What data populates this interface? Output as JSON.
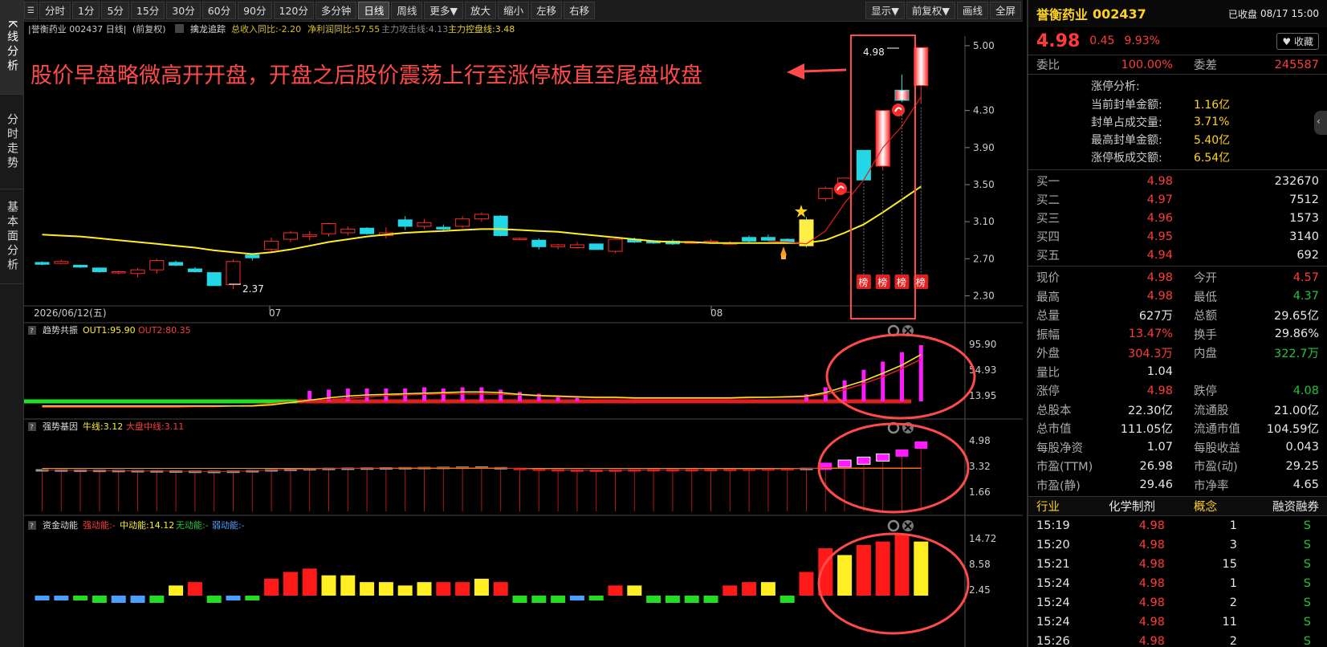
{
  "vtabs": [
    "K线分析",
    "分时走势",
    "基本面分析"
  ],
  "toolbar": {
    "left": [
      "分时",
      "1分",
      "5分",
      "15分",
      "30分",
      "60分",
      "90分",
      "120分",
      "多分钟",
      "日线",
      "周线",
      "更多▼",
      "放大",
      "缩小",
      "左移",
      "右移"
    ],
    "active": "日线",
    "right": [
      "显示▼",
      "前复权▼",
      "画线",
      "全屏"
    ]
  },
  "chart_header": {
    "stock": "|誉衡药业 002437 日线|",
    "adj": "(前复权)",
    "indicator": "擒龙追踪",
    "revenue": "总收入同比:-2.20",
    "profit": "净利润同比:57.55",
    "attack": "主力攻击线:4.13",
    "control": "主力控盘线:3.48"
  },
  "annotation": "股价早盘略微高开开盘，开盘之后股价震荡上行至涨停板直至尾盘收盘",
  "main_axis": [
    "5.00",
    "4.30",
    "3.90",
    "3.50",
    "3.10",
    "2.70",
    "2.30"
  ],
  "date_labels": [
    "2026/06/12(五)",
    "07",
    "08"
  ],
  "price_marks": {
    "low": "2.37",
    "high": "4.98"
  },
  "bang": "榜",
  "panels": {
    "p1": {
      "q": "?",
      "name": "趋势共振",
      "v1": "OUT1:95.90",
      "v2": "OUT2:80.35",
      "axis": [
        "95.90",
        "54.93",
        "13.95"
      ]
    },
    "p2": {
      "q": "?",
      "name": "强势基因",
      "v1": "牛线:3.12",
      "v2": "大盘中线:3.11",
      "axis": [
        "4.98",
        "3.32",
        "1.66"
      ]
    },
    "p3": {
      "q": "?",
      "name": "资金动能",
      "v1": "强动能:-",
      "v2": "中动能:14.12",
      "v3": "无动能:-",
      "v4": "弱动能:-",
      "axis": [
        "14.72",
        "8.58",
        "2.45"
      ]
    }
  },
  "chart_data": {
    "type": "candlestick",
    "ohlc": [
      [
        2.66,
        2.67,
        2.63,
        2.64
      ],
      [
        2.65,
        2.69,
        2.64,
        2.67
      ],
      [
        2.63,
        2.63,
        2.6,
        2.61
      ],
      [
        2.6,
        2.6,
        2.55,
        2.56
      ],
      [
        2.55,
        2.57,
        2.53,
        2.56
      ],
      [
        2.54,
        2.6,
        2.5,
        2.58
      ],
      [
        2.58,
        2.7,
        2.54,
        2.68
      ],
      [
        2.66,
        2.68,
        2.62,
        2.63
      ],
      [
        2.59,
        2.61,
        2.55,
        2.56
      ],
      [
        2.55,
        2.55,
        2.41,
        2.41
      ],
      [
        2.42,
        2.69,
        2.37,
        2.67
      ],
      [
        2.74,
        2.76,
        2.68,
        2.71
      ],
      [
        2.8,
        2.93,
        2.78,
        2.89
      ],
      [
        2.91,
        3.0,
        2.88,
        2.98
      ],
      [
        2.94,
        3.0,
        2.9,
        2.96
      ],
      [
        2.97,
        3.09,
        2.94,
        3.08
      ],
      [
        2.98,
        3.05,
        2.95,
        3.02
      ],
      [
        3.03,
        3.04,
        2.96,
        2.97
      ],
      [
        2.95,
        3.04,
        2.92,
        2.98
      ],
      [
        3.12,
        3.16,
        3.01,
        3.05
      ],
      [
        3.05,
        3.13,
        3.02,
        3.09
      ],
      [
        3.04,
        3.07,
        2.99,
        3.02
      ],
      [
        3.05,
        3.16,
        3.03,
        3.13
      ],
      [
        3.13,
        3.2,
        3.1,
        3.18
      ],
      [
        3.16,
        3.17,
        2.94,
        2.95
      ],
      [
        2.92,
        2.93,
        2.9,
        2.92
      ],
      [
        2.9,
        2.92,
        2.8,
        2.83
      ],
      [
        2.83,
        2.86,
        2.8,
        2.85
      ],
      [
        2.82,
        2.88,
        2.81,
        2.85
      ],
      [
        2.86,
        2.86,
        2.8,
        2.8
      ],
      [
        2.78,
        2.92,
        2.76,
        2.91
      ],
      [
        2.91,
        2.93,
        2.87,
        2.88
      ],
      [
        2.89,
        2.9,
        2.86,
        2.87
      ],
      [
        2.89,
        2.91,
        2.85,
        2.86
      ],
      [
        2.88,
        2.89,
        2.86,
        2.88
      ],
      [
        2.88,
        2.91,
        2.87,
        2.89
      ],
      [
        2.87,
        2.89,
        2.85,
        2.87
      ],
      [
        2.93,
        2.95,
        2.87,
        2.89
      ],
      [
        2.93,
        2.96,
        2.89,
        2.9
      ],
      [
        2.91,
        2.92,
        2.86,
        2.87
      ],
      [
        3.12,
        3.15,
        2.82,
        2.84
      ],
      [
        3.35,
        3.48,
        3.32,
        3.46
      ],
      [
        3.42,
        3.53,
        3.42,
        3.57
      ],
      [
        3.87,
        3.87,
        3.55,
        3.55
      ],
      [
        3.7,
        4.3,
        3.65,
        4.3
      ],
      [
        4.52,
        4.69,
        4.39,
        4.41
      ],
      [
        4.57,
        4.98,
        4.37,
        4.98
      ]
    ],
    "ma_yellow": [
      2.96,
      2.95,
      2.94,
      2.92,
      2.9,
      2.88,
      2.86,
      2.84,
      2.82,
      2.79,
      2.77,
      2.75,
      2.77,
      2.8,
      2.84,
      2.88,
      2.91,
      2.94,
      2.96,
      2.98,
      2.99,
      3.0,
      3.01,
      3.02,
      3.02,
      3.01,
      3.0,
      2.99,
      2.97,
      2.95,
      2.93,
      2.91,
      2.89,
      2.88,
      2.88,
      2.87,
      2.87,
      2.87,
      2.87,
      2.87,
      2.87,
      2.9,
      2.98,
      3.07,
      3.2,
      3.34,
      3.48
    ],
    "ma_red": [
      2.64,
      2.66,
      2.64,
      2.61,
      2.59,
      2.6,
      2.63,
      2.64,
      2.61,
      2.55,
      2.59,
      2.69,
      2.82,
      2.93,
      2.97,
      3.02,
      3.05,
      3.01,
      3.0,
      3.04,
      3.06,
      3.03,
      3.08,
      3.13,
      3.0,
      2.95,
      2.88,
      2.86,
      2.84,
      2.82,
      2.86,
      2.87,
      2.87,
      2.87,
      2.88,
      2.89,
      2.88,
      2.89,
      2.89,
      2.88,
      2.86,
      3.0,
      3.3,
      3.55,
      3.9,
      4.13,
      4.45
    ],
    "p1_a": [
      -8,
      -8,
      -8,
      -8,
      -8,
      -8,
      -8,
      -8,
      -8,
      -8,
      -8,
      -8,
      -6,
      -2,
      2,
      6,
      9,
      11,
      12,
      13,
      14,
      15,
      16,
      16,
      15,
      12,
      10,
      9,
      8,
      7,
      7,
      6,
      6,
      6,
      6,
      6,
      6,
      7,
      7,
      8,
      9,
      15,
      25,
      35,
      48,
      62,
      80
    ],
    "p1_b": [
      -10,
      -10,
      -10,
      -10,
      -10,
      -10,
      -10,
      -10,
      -9,
      -9,
      -8,
      -7,
      -4,
      -1,
      1,
      3,
      5,
      8,
      10,
      11,
      12,
      13,
      13,
      13,
      12,
      11,
      9,
      8,
      7,
      6,
      6,
      5,
      5,
      5,
      5,
      5,
      5,
      6,
      7,
      7,
      8,
      12,
      20,
      30,
      42,
      56,
      72
    ],
    "p1_bars": [
      0,
      0,
      0,
      0,
      0,
      0,
      0,
      0,
      0,
      0,
      0,
      0,
      0,
      0,
      18,
      20,
      22,
      22,
      22,
      22,
      24,
      22,
      24,
      24,
      20,
      16,
      13,
      10,
      6,
      0,
      0,
      0,
      0,
      0,
      0,
      0,
      0,
      0,
      0,
      0,
      12,
      24,
      36,
      54,
      68,
      84,
      96
    ],
    "p2_bars": [
      3.32,
      3.31,
      3.3,
      3.29,
      3.28,
      3.27,
      3.26,
      3.25,
      3.24,
      3.23,
      3.24,
      3.27,
      3.32,
      3.35,
      3.38,
      3.4,
      3.41,
      3.42,
      3.43,
      3.44,
      3.45,
      3.46,
      3.47,
      3.48,
      3.44,
      3.4,
      3.36,
      3.33,
      3.31,
      3.3,
      3.31,
      3.32,
      3.33,
      3.33,
      3.33,
      3.34,
      3.35,
      3.36,
      3.37,
      3.38,
      3.4,
      3.55,
      3.7,
      3.87,
      4.05,
      4.3,
      4.75
    ],
    "p3_bars": [
      2,
      2,
      2,
      3,
      3,
      3,
      3,
      3,
      4,
      3,
      2,
      2,
      5,
      7,
      8,
      6,
      6,
      4,
      4,
      3,
      4,
      4,
      4,
      5,
      4,
      3,
      3,
      3,
      2,
      2,
      3,
      3,
      3,
      3,
      3,
      3,
      3,
      4,
      4,
      3,
      7,
      14,
      12,
      15,
      16,
      18,
      16
    ],
    "p3_colors": [
      "blue",
      "blue",
      "green",
      "green",
      "blue",
      "blue",
      "green",
      "yellow",
      "red",
      "green",
      "blue",
      "green",
      "red",
      "red",
      "red",
      "yellow",
      "yellow",
      "yellow",
      "yellow",
      "yellow",
      "yellow",
      "red",
      "red",
      "yellow",
      "red",
      "green",
      "green",
      "green",
      "blue",
      "green",
      "red",
      "yellow",
      "green",
      "green",
      "green",
      "green",
      "red",
      "red",
      "yellow",
      "green",
      "red",
      "red",
      "yellow",
      "red",
      "red",
      "red",
      "yellow"
    ]
  },
  "quote": {
    "name": "誉衡药业",
    "code": "002437",
    "status": "已收盘",
    "date": "08/17 15:00",
    "price": "4.98",
    "change": "0.45",
    "pct": "9.93%",
    "fav": "♥ 收藏",
    "webi_label": "委比",
    "webi": "100.00%",
    "weicha_label": "委差",
    "weicha": "245587"
  },
  "zt_analysis": {
    "title": "涨停分析:",
    "rows": [
      {
        "k": "当前封单金额:",
        "v": "1.16亿"
      },
      {
        "k": "封单占成交量:",
        "v": "3.71%"
      },
      {
        "k": "最高封单金额:",
        "v": "5.40亿"
      },
      {
        "k": "涨停板成交额:",
        "v": "6.54亿"
      }
    ]
  },
  "buy_levels": [
    {
      "k": "买一",
      "p": "4.98",
      "v": "232670"
    },
    {
      "k": "买二",
      "p": "4.97",
      "v": "7512"
    },
    {
      "k": "买三",
      "p": "4.96",
      "v": "1573"
    },
    {
      "k": "买四",
      "p": "4.95",
      "v": "3140"
    },
    {
      "k": "买五",
      "p": "4.94",
      "v": "692"
    }
  ],
  "stats": [
    {
      "k1": "现价",
      "v1": "4.98",
      "c1": "red",
      "k2": "今开",
      "v2": "4.57",
      "c2": "red"
    },
    {
      "k1": "最高",
      "v1": "4.98",
      "c1": "red",
      "k2": "最低",
      "v2": "4.37",
      "c2": "green"
    },
    {
      "k1": "总量",
      "v1": "627万",
      "c1": "white",
      "k2": "总额",
      "v2": "29.65亿",
      "c2": "white"
    },
    {
      "k1": "振幅",
      "v1": "13.47%",
      "c1": "red",
      "k2": "换手",
      "v2": "29.86%",
      "c2": "white"
    },
    {
      "k1": "外盘",
      "v1": "304.3万",
      "c1": "red",
      "k2": "内盘",
      "v2": "322.7万",
      "c2": "green"
    },
    {
      "k1": "量比",
      "v1": "1.04",
      "c1": "white",
      "k2": "",
      "v2": "",
      "c2": "white"
    },
    {
      "k1": "涨停",
      "v1": "4.98",
      "c1": "red",
      "k2": "跌停",
      "v2": "4.08",
      "c2": "green"
    },
    {
      "k1": "总股本",
      "v1": "22.30亿",
      "c1": "white",
      "k2": "流通股",
      "v2": "21.00亿",
      "c2": "white"
    },
    {
      "k1": "总市值",
      "v1": "111.05亿",
      "c1": "white",
      "k2": "流通市值",
      "v2": "104.59亿",
      "c2": "white"
    },
    {
      "k1": "每股净资",
      "v1": "1.07",
      "c1": "white",
      "k2": "每股收益",
      "v2": "0.043",
      "c2": "white"
    },
    {
      "k1": "市盈(TTM)",
      "v1": "26.98",
      "c1": "white",
      "k2": "市盈(动)",
      "v2": "29.25",
      "c2": "white"
    },
    {
      "k1": "市盈(静)",
      "v1": "29.46",
      "c1": "white",
      "k2": "市净率",
      "v2": "4.65",
      "c2": "white"
    }
  ],
  "industry_row": {
    "a": "行业",
    "b": "化学制剂",
    "c": "概念",
    "d": "融资融券"
  },
  "ticks": [
    {
      "t": "15:19",
      "p": "4.98",
      "v": "1",
      "s": "S"
    },
    {
      "t": "15:20",
      "p": "4.98",
      "v": "3",
      "s": "S"
    },
    {
      "t": "15:21",
      "p": "4.98",
      "v": "15",
      "s": "S"
    },
    {
      "t": "15:24",
      "p": "4.98",
      "v": "1",
      "s": "S"
    },
    {
      "t": "15:24",
      "p": "4.98",
      "v": "2",
      "s": "S"
    },
    {
      "t": "15:24",
      "p": "4.98",
      "v": "11",
      "s": "S"
    },
    {
      "t": "15:26",
      "p": "4.98",
      "v": "2",
      "s": "S"
    }
  ],
  "colors": {
    "up": "#ff2b2b",
    "down": "#22d7e6",
    "ma_yellow": "#ffee22",
    "ma_red": "#e02020",
    "magenta": "#ff1aff",
    "circle": "#ff4a4a"
  }
}
